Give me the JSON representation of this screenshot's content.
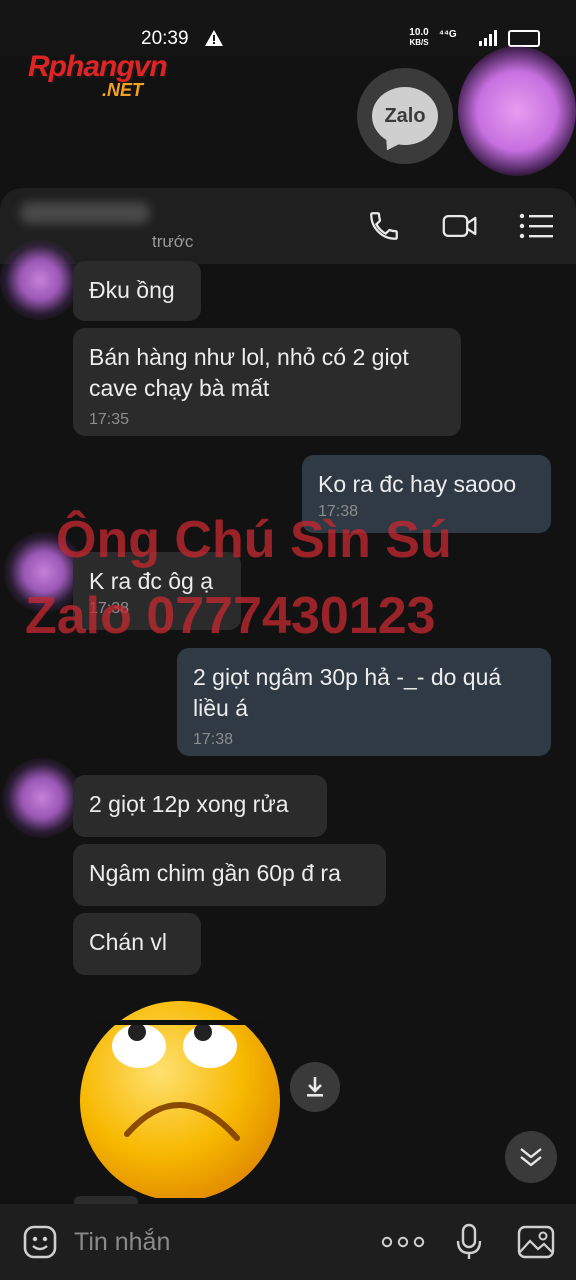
{
  "status_bar": {
    "time": "20:39",
    "speed_value": "10.0",
    "speed_unit": "KB/S",
    "network": "⁴⁴G"
  },
  "watermark_logo": {
    "main": "Rphangvn",
    "sub": ".NET"
  },
  "floating_bubble": {
    "label": "Zalo"
  },
  "header": {
    "last_seen": "trước"
  },
  "messages": [
    {
      "side": "in",
      "text": "Đku ồng",
      "time": ""
    },
    {
      "side": "in",
      "text": "Bán hàng như lol, nhỏ có 2 giọt cave chạy bà mất",
      "time": "17:35"
    },
    {
      "side": "out",
      "text": "Ko ra đc hay saooo",
      "time": "17:38"
    },
    {
      "side": "in",
      "text": "K ra đc ôg ạ",
      "time": "17:38"
    },
    {
      "side": "out",
      "text": "2 giọt ngâm 30p hả -_- do quá liều á",
      "time": "17:38"
    },
    {
      "side": "in",
      "text": "2 giọt 12p xong rửa",
      "time": ""
    },
    {
      "side": "in",
      "text": "Ngâm chim gần 60p đ ra",
      "time": ""
    },
    {
      "side": "in",
      "text": "Chán vl",
      "time": ""
    }
  ],
  "overlay_watermark": {
    "line1": "Ông Chú Sìn Sú",
    "line2": "Zalo 0777430123"
  },
  "composer": {
    "placeholder": "Tin nhắn"
  },
  "colors": {
    "background": "#121212",
    "incoming_bubble": "#2b2b2b",
    "outgoing_bubble": "#2f3a45",
    "watermark_red": "#c82832"
  }
}
